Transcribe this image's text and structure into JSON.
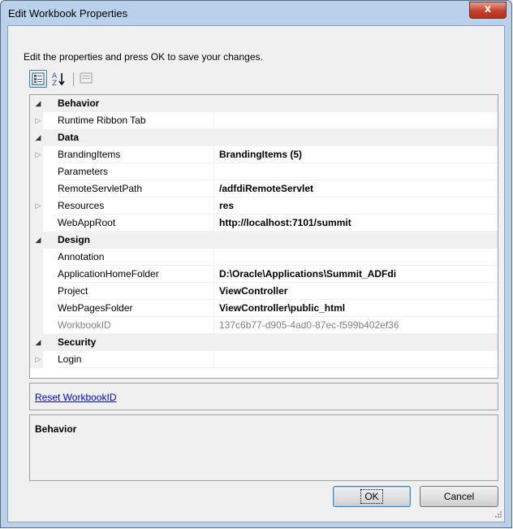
{
  "window": {
    "title": "Edit Workbook Properties",
    "close_label": "x"
  },
  "instructions": "Edit the properties and press OK to save your changes.",
  "toolbar": {
    "categorized_icon": "categorized-icon",
    "alphabetical_icon": "sort-az-icon",
    "pages_icon": "property-pages-icon"
  },
  "grid": {
    "categories": {
      "behavior": "Behavior",
      "data": "Data",
      "design": "Design",
      "security": "Security"
    },
    "properties": {
      "runtime_ribbon_tab": {
        "name": "Runtime Ribbon Tab",
        "value": ""
      },
      "branding_items": {
        "name": "BrandingItems",
        "value": "BrandingItems (5)"
      },
      "parameters": {
        "name": "Parameters",
        "value": ""
      },
      "remote_servlet_path": {
        "name": "RemoteServletPath",
        "value": "/adfdiRemoteServlet"
      },
      "resources": {
        "name": "Resources",
        "value": "res"
      },
      "web_app_root": {
        "name": "WebAppRoot",
        "value": "http://localhost:7101/summit"
      },
      "annotation": {
        "name": "Annotation",
        "value": ""
      },
      "application_home_folder": {
        "name": "ApplicationHomeFolder",
        "value": "D:\\Oracle\\Applications\\Summit_ADFdi"
      },
      "project": {
        "name": "Project",
        "value": "ViewController"
      },
      "web_pages_folder": {
        "name": "WebPagesFolder",
        "value": "ViewController\\public_html"
      },
      "workbook_id": {
        "name": "WorkbookID",
        "value": "137c6b77-d905-4ad0-87ec-f599b402ef36"
      },
      "login": {
        "name": "Login",
        "value": ""
      }
    }
  },
  "command_link": "Reset WorkbookID",
  "description": {
    "title": "Behavior"
  },
  "buttons": {
    "ok": "OK",
    "cancel": "Cancel"
  },
  "colors": {
    "frame": "#b9d1ea",
    "panel": "#f0f0f0",
    "link": "#0000ee",
    "readonly_text": "#808080"
  }
}
